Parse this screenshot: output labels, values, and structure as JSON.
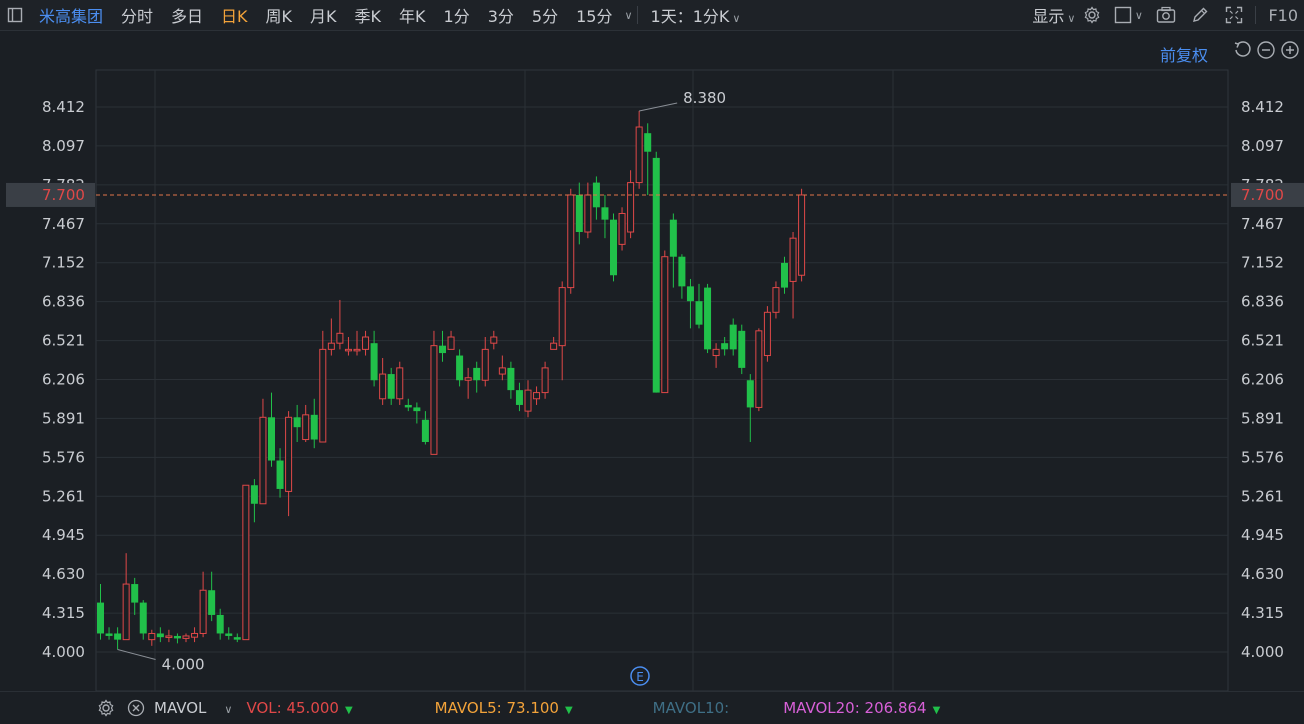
{
  "toolbar": {
    "brand": "米高集团",
    "tabs": [
      "分时",
      "多日",
      "日K",
      "周K",
      "月K",
      "季K",
      "年K",
      "1分",
      "3分",
      "5分",
      "15分"
    ],
    "active_tab": "日K",
    "period_select": "1天：1分K",
    "display": "显示",
    "f10": "F10"
  },
  "adjust_label": "前复权",
  "price_axis": {
    "ticks": [
      "8.412",
      "8.097",
      "7.782",
      "7.467",
      "7.152",
      "6.836",
      "6.521",
      "6.206",
      "5.891",
      "5.576",
      "5.261",
      "4.945",
      "4.630",
      "4.315",
      "4.000"
    ],
    "current_price": "7.700",
    "high_label": "8.380",
    "low_label": "4.000"
  },
  "event_marker": "E",
  "volume_bar": {
    "indicator": "MAVOL",
    "vol_label": "VOL:",
    "vol_value": "45.000",
    "mavol5_label": "MAVOL5:",
    "mavol5_value": "73.100",
    "mavol10_label": "MAVOL10:",
    "mavol20_label": "MAVOL20:",
    "mavol20_value": "206.864"
  },
  "colors": {
    "up": "#e04848",
    "down": "#21c04a",
    "accent": "#f3a33a",
    "brand": "#4b8ef0",
    "vol": "#e04848",
    "mavol5": "#f3a33a",
    "mavol10": "#3f6f86",
    "mavol20": "#d860d8"
  },
  "chart_data": {
    "type": "candlestick",
    "ylim": [
      4.0,
      8.412
    ],
    "candles": [
      [
        4.4,
        4.15,
        4.55,
        4.1
      ],
      [
        4.15,
        4.13,
        4.2,
        4.1
      ],
      [
        4.15,
        4.1,
        4.2,
        4.02
      ],
      [
        4.1,
        4.55,
        4.8,
        4.1
      ],
      [
        4.55,
        4.4,
        4.6,
        4.3
      ],
      [
        4.4,
        4.15,
        4.42,
        4.1
      ],
      [
        4.1,
        4.15,
        4.18,
        4.05
      ],
      [
        4.15,
        4.12,
        4.2,
        4.08
      ],
      [
        4.12,
        4.13,
        4.18,
        4.08
      ],
      [
        4.13,
        4.11,
        4.15,
        4.07
      ],
      [
        4.11,
        4.13,
        4.15,
        4.08
      ],
      [
        4.12,
        4.15,
        4.2,
        4.08
      ],
      [
        4.15,
        4.5,
        4.65,
        4.12
      ],
      [
        4.5,
        4.3,
        4.65,
        4.25
      ],
      [
        4.3,
        4.15,
        4.35,
        4.1
      ],
      [
        4.15,
        4.13,
        4.2,
        4.1
      ],
      [
        4.12,
        4.1,
        4.15,
        4.08
      ],
      [
        4.1,
        5.35,
        5.35,
        4.1
      ],
      [
        5.35,
        5.2,
        5.4,
        5.05
      ],
      [
        5.2,
        5.9,
        6.05,
        5.2
      ],
      [
        5.9,
        5.55,
        6.1,
        5.5
      ],
      [
        5.55,
        5.32,
        5.65,
        5.25
      ],
      [
        5.3,
        5.9,
        5.95,
        5.1
      ],
      [
        5.9,
        5.82,
        6.0,
        5.7
      ],
      [
        5.72,
        5.92,
        6.0,
        5.7
      ],
      [
        5.92,
        5.72,
        6.05,
        5.65
      ],
      [
        5.7,
        6.45,
        6.6,
        5.7
      ],
      [
        6.45,
        6.5,
        6.7,
        6.4
      ],
      [
        6.5,
        6.58,
        6.85,
        6.45
      ],
      [
        6.45,
        6.45,
        6.55,
        6.4
      ],
      [
        6.45,
        6.45,
        6.6,
        6.4
      ],
      [
        6.45,
        6.55,
        6.6,
        6.4
      ],
      [
        6.5,
        6.2,
        6.6,
        6.15
      ],
      [
        6.05,
        6.25,
        6.38,
        6.0
      ],
      [
        6.25,
        6.05,
        6.3,
        6.0
      ],
      [
        6.05,
        6.3,
        6.35,
        6.0
      ],
      [
        6.0,
        5.98,
        6.05,
        5.95
      ],
      [
        5.98,
        5.95,
        6.02,
        5.85
      ],
      [
        5.88,
        5.7,
        5.95,
        5.68
      ],
      [
        5.6,
        6.48,
        6.6,
        5.6
      ],
      [
        6.48,
        6.42,
        6.6,
        6.35
      ],
      [
        6.45,
        6.55,
        6.6,
        6.45
      ],
      [
        6.4,
        6.2,
        6.45,
        6.15
      ],
      [
        6.2,
        6.22,
        6.3,
        6.05
      ],
      [
        6.3,
        6.2,
        6.35,
        6.1
      ],
      [
        6.2,
        6.45,
        6.55,
        6.15
      ],
      [
        6.5,
        6.55,
        6.6,
        6.45
      ],
      [
        6.25,
        6.3,
        6.4,
        6.2
      ],
      [
        6.3,
        6.12,
        6.35,
        6.05
      ],
      [
        6.12,
        6.0,
        6.18,
        5.95
      ],
      [
        5.95,
        6.12,
        6.2,
        5.9
      ],
      [
        6.05,
        6.1,
        6.15,
        6.0
      ],
      [
        6.1,
        6.3,
        6.35,
        6.05
      ],
      [
        6.45,
        6.5,
        6.55,
        6.45
      ],
      [
        6.48,
        6.95,
        7.0,
        6.2
      ],
      [
        6.95,
        7.7,
        7.75,
        6.9
      ],
      [
        7.7,
        7.4,
        7.8,
        7.3
      ],
      [
        7.4,
        7.7,
        7.8,
        7.35
      ],
      [
        7.8,
        7.6,
        7.85,
        7.5
      ],
      [
        7.6,
        7.5,
        7.7,
        7.35
      ],
      [
        7.5,
        7.05,
        7.55,
        7.0
      ],
      [
        7.3,
        7.55,
        7.6,
        7.25
      ],
      [
        7.4,
        7.8,
        7.9,
        7.35
      ],
      [
        7.8,
        8.25,
        8.38,
        7.75
      ],
      [
        8.2,
        8.05,
        8.28,
        7.7
      ],
      [
        8.0,
        6.1,
        8.05,
        6.1
      ],
      [
        6.1,
        7.2,
        7.25,
        6.1
      ],
      [
        7.5,
        7.2,
        7.55,
        6.95
      ],
      [
        7.2,
        6.96,
        7.22,
        6.86
      ],
      [
        6.96,
        6.84,
        7.02,
        6.62
      ],
      [
        6.84,
        6.65,
        6.98,
        6.62
      ],
      [
        6.95,
        6.45,
        6.98,
        6.42
      ],
      [
        6.4,
        6.45,
        6.5,
        6.3
      ],
      [
        6.5,
        6.45,
        6.55,
        6.4
      ],
      [
        6.65,
        6.45,
        6.7,
        6.4
      ],
      [
        6.6,
        6.3,
        6.65,
        6.25
      ],
      [
        6.2,
        5.98,
        6.25,
        5.7
      ],
      [
        5.98,
        6.6,
        6.62,
        5.95
      ],
      [
        6.4,
        6.75,
        6.8,
        6.35
      ],
      [
        6.75,
        6.95,
        7.0,
        6.7
      ],
      [
        7.15,
        6.95,
        7.2,
        6.9
      ],
      [
        7.0,
        7.35,
        7.4,
        6.7
      ],
      [
        7.05,
        7.7,
        7.75,
        7.0
      ]
    ]
  }
}
